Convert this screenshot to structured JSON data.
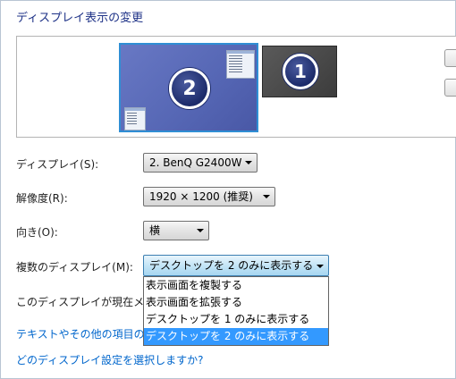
{
  "title": "ディスプレイ表示の変更",
  "monitors": [
    {
      "number": "2",
      "selected": true
    },
    {
      "number": "1",
      "selected": false
    }
  ],
  "fields": {
    "display_label": "ディスプレイ(S):",
    "display_value": "2. BenQ G2400W",
    "resolution_label": "解像度(R):",
    "resolution_value": "1920 × 1200 (推奨)",
    "orientation_label": "向き(O):",
    "orientation_value": "横",
    "multi_label": "複数のディスプレイ(M):",
    "multi_value": "デスクトップを 2 のみに表示する"
  },
  "multi_options": [
    "表示画面を複製する",
    "表示画面を拡張する",
    "デスクトップを 1 のみに表示する",
    "デスクトップを 2 のみに表示する"
  ],
  "status_text": "このディスプレイが現在メ",
  "links": {
    "text_size": "テキストやその他の項目の",
    "which_setting": "どのディスプレイ設定を選択しますか?"
  },
  "colors": {
    "title": "#1e3287",
    "link": "#0066cc",
    "selected_option": "#3399ff"
  }
}
